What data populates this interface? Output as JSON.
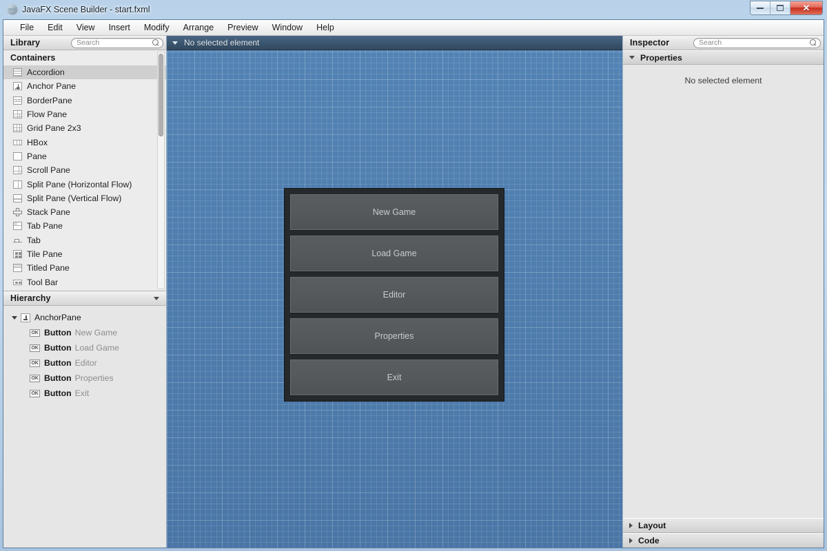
{
  "window": {
    "title": "JavaFX Scene Builder - start.fxml",
    "app_icon": "scene-builder-icon",
    "controls": {
      "minimize": "minimize-icon",
      "maximize": "maximize-icon",
      "close": "✕"
    }
  },
  "menubar": {
    "items": [
      {
        "label": "File"
      },
      {
        "label": "Edit"
      },
      {
        "label": "View"
      },
      {
        "label": "Insert"
      },
      {
        "label": "Modify"
      },
      {
        "label": "Arrange"
      },
      {
        "label": "Preview"
      },
      {
        "label": "Window"
      },
      {
        "label": "Help"
      }
    ]
  },
  "library": {
    "title": "Library",
    "search_placeholder": "Search",
    "search_value": "",
    "group_label": "Containers",
    "items": [
      {
        "label": "Accordion",
        "icon": "accordion-icon",
        "selected": true
      },
      {
        "label": "Anchor Pane",
        "icon": "anchor-pane-icon",
        "selected": false
      },
      {
        "label": "BorderPane",
        "icon": "border-pane-icon",
        "selected": false
      },
      {
        "label": "Flow Pane",
        "icon": "flow-pane-icon",
        "selected": false
      },
      {
        "label": "Grid Pane 2x3",
        "icon": "grid-pane-icon",
        "selected": false
      },
      {
        "label": "HBox",
        "icon": "hbox-icon",
        "selected": false
      },
      {
        "label": "Pane",
        "icon": "pane-icon",
        "selected": false
      },
      {
        "label": "Scroll Pane",
        "icon": "scroll-pane-icon",
        "selected": false
      },
      {
        "label": "Split Pane (Horizontal Flow)",
        "icon": "split-pane-horizontal-icon",
        "selected": false
      },
      {
        "label": "Split Pane (Vertical Flow)",
        "icon": "split-pane-vertical-icon",
        "selected": false
      },
      {
        "label": "Stack Pane",
        "icon": "stack-pane-icon",
        "selected": false
      },
      {
        "label": "Tab Pane",
        "icon": "tab-pane-icon",
        "selected": false
      },
      {
        "label": "Tab",
        "icon": "tab-icon",
        "selected": false
      },
      {
        "label": "Tile Pane",
        "icon": "tile-pane-icon",
        "selected": false
      },
      {
        "label": "Titled Pane",
        "icon": "titled-pane-icon",
        "selected": false
      },
      {
        "label": "Tool Bar",
        "icon": "tool-bar-icon",
        "selected": false
      }
    ]
  },
  "hierarchy": {
    "title": "Hierarchy",
    "root": {
      "label": "AnchorPane",
      "icon": "anchor-pane-icon",
      "expanded": true
    },
    "children": [
      {
        "type": "Button",
        "name": "New Game",
        "icon": "button-ok-icon"
      },
      {
        "type": "Button",
        "name": "Load Game",
        "icon": "button-ok-icon"
      },
      {
        "type": "Button",
        "name": "Editor",
        "icon": "button-ok-icon"
      },
      {
        "type": "Button",
        "name": "Properties",
        "icon": "button-ok-icon"
      },
      {
        "type": "Button",
        "name": "Exit",
        "icon": "button-ok-icon"
      }
    ]
  },
  "content": {
    "breadcrumb": "No selected element",
    "design": {
      "root_type": "AnchorPane",
      "buttons": [
        {
          "label": "New Game"
        },
        {
          "label": "Load Game"
        },
        {
          "label": "Editor"
        },
        {
          "label": "Properties"
        },
        {
          "label": "Exit"
        }
      ]
    }
  },
  "inspector": {
    "title": "Inspector",
    "search_placeholder": "Search",
    "search_value": "",
    "sections": [
      {
        "label": "Properties",
        "expanded": true
      },
      {
        "label": "Layout",
        "expanded": false
      },
      {
        "label": "Code",
        "expanded": false
      }
    ],
    "empty_message": "No selected element"
  },
  "colors": {
    "canvas_blue": "#4f7dae",
    "design_root_bg": "#26292c",
    "fx_button_bg": "#56595c",
    "fx_button_text": "#c8cacb",
    "breadcrumb_bg": "#3d5872",
    "close_button_red": "#c8301f",
    "selection_grey": "#cfcfcf"
  }
}
